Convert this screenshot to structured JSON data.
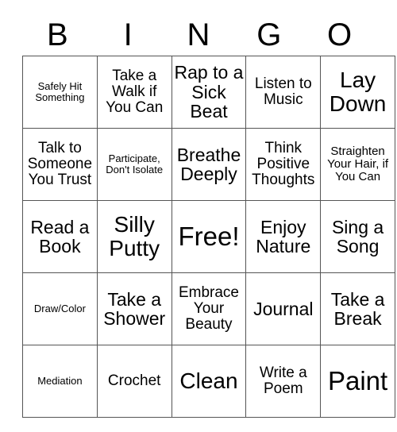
{
  "card": {
    "header_letters": [
      "B",
      "I",
      "N",
      "G",
      "O"
    ],
    "rows": [
      [
        {
          "text": "Safely Hit Something",
          "size": "fs-xs"
        },
        {
          "text": "Take a Walk if You Can",
          "size": "fs-md"
        },
        {
          "text": "Rap to a Sick Beat",
          "size": "fs-lg"
        },
        {
          "text": "Listen to Music",
          "size": "fs-md"
        },
        {
          "text": "Lay Down",
          "size": "fs-xl"
        }
      ],
      [
        {
          "text": "Talk to Someone You Trust",
          "size": "fs-md"
        },
        {
          "text": "Participate, Don't Isolate",
          "size": "fs-xs"
        },
        {
          "text": "Breathe Deeply",
          "size": "fs-lg"
        },
        {
          "text": "Think Positive Thoughts",
          "size": "fs-md"
        },
        {
          "text": "Straighten Your Hair, if You Can",
          "size": "fs-sm"
        }
      ],
      [
        {
          "text": "Read a Book",
          "size": "fs-lg"
        },
        {
          "text": "Silly Putty",
          "size": "fs-xl"
        },
        {
          "text": "Free!",
          "size": "fs-xxl"
        },
        {
          "text": "Enjoy Nature",
          "size": "fs-lg"
        },
        {
          "text": "Sing a Song",
          "size": "fs-lg"
        }
      ],
      [
        {
          "text": "Draw/Color",
          "size": "fs-xs"
        },
        {
          "text": "Take a Shower",
          "size": "fs-lg"
        },
        {
          "text": "Embrace Your Beauty",
          "size": "fs-md"
        },
        {
          "text": "Journal",
          "size": "fs-lg"
        },
        {
          "text": "Take a Break",
          "size": "fs-lg"
        }
      ],
      [
        {
          "text": "Mediation",
          "size": "fs-xs"
        },
        {
          "text": "Crochet",
          "size": "fs-md"
        },
        {
          "text": "Clean",
          "size": "fs-xl"
        },
        {
          "text": "Write a Poem",
          "size": "fs-md"
        },
        {
          "text": "Paint",
          "size": "fs-xxl"
        }
      ]
    ]
  },
  "colors": {
    "text": "#000000",
    "grid_border": "#555555",
    "background": "#ffffff"
  }
}
